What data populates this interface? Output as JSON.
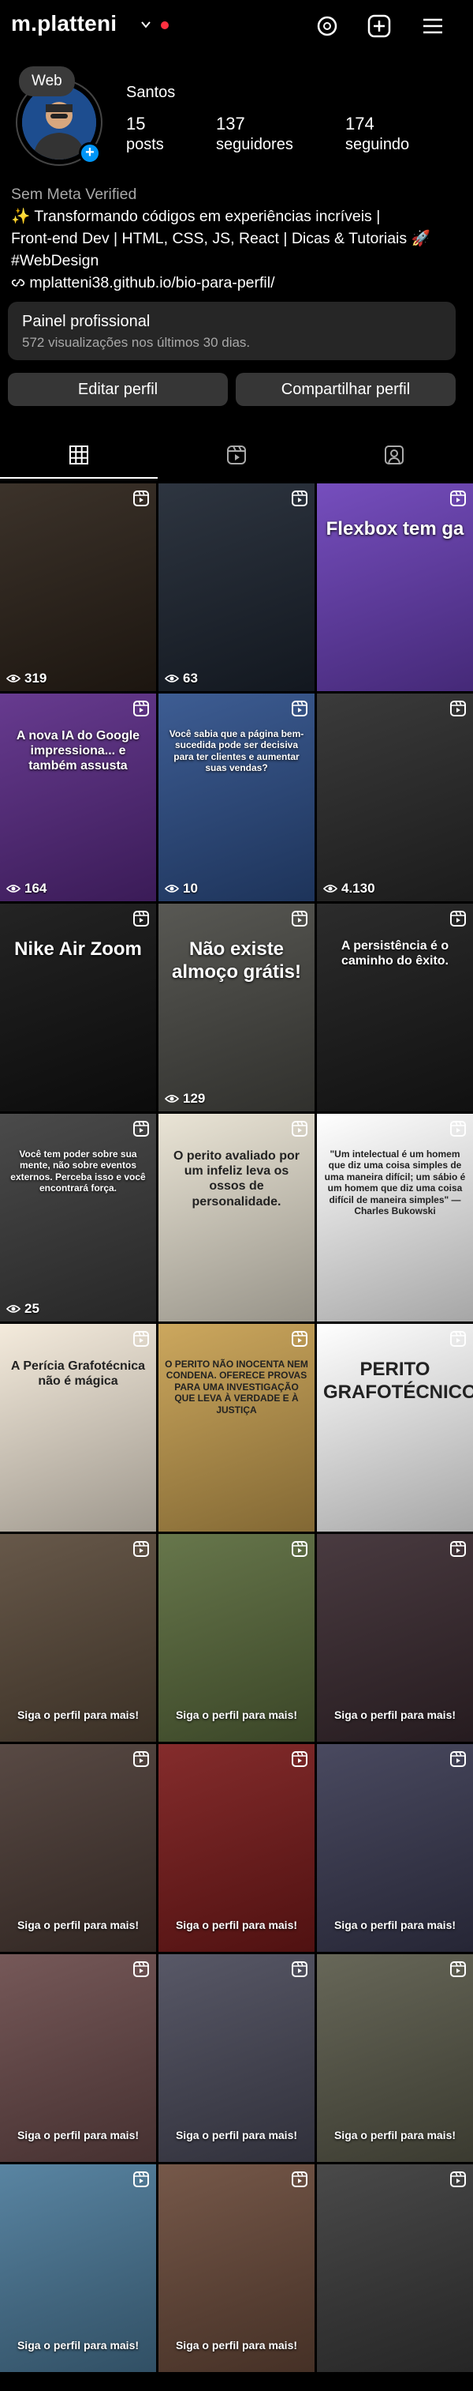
{
  "header": {
    "username": "m.platteni",
    "note": "Web"
  },
  "profile": {
    "full_name": "Santos",
    "stats": [
      {
        "value": "15",
        "label": "posts"
      },
      {
        "value": "137",
        "label": "seguidores"
      },
      {
        "value": "174",
        "label": "seguindo"
      }
    ],
    "meta_verified": "Sem Meta Verified",
    "bio_lines": [
      "✨ Transformando códigos em experiências incríveis |",
      "Front-end Dev | HTML, CSS, JS, React | Dicas & Tutoriais 🚀",
      "#WebDesign"
    ],
    "link": "mplatteni38.github.io/bio-para-perfil/"
  },
  "pro_dashboard": {
    "title": "Painel profissional",
    "subtitle": "572 visualizações nos últimos 30 dias."
  },
  "buttons": {
    "edit": "Editar perfil",
    "share": "Compartilhar perfil"
  },
  "tabs": [
    "posts-grid-icon",
    "reels-icon",
    "tagged-icon"
  ],
  "posts": [
    {
      "views": "319",
      "bg": "#2b2118"
    },
    {
      "views": "63",
      "bg": "#1c2430"
    },
    {
      "views": "",
      "bg": "#6a3fb8",
      "caption": "Flexbox tem ga"
    },
    {
      "views": "164",
      "bg": "#5a2a86",
      "caption": "A nova IA do Google impressiona... e também assusta"
    },
    {
      "views": "10",
      "bg": "#2d4f8a",
      "caption": "Você sabia que a página bem-sucedida pode ser decisiva para ter clientes e aumentar suas vendas?"
    },
    {
      "views": "4.130",
      "bg": "#2a2a2a"
    },
    {
      "views": "",
      "bg": "#111111",
      "caption": "Nike Air Zoom"
    },
    {
      "views": "129",
      "bg": "#4a4a45",
      "caption": "Não existe almoço grátis!"
    },
    {
      "views": "",
      "bg": "#1a1a1a",
      "caption": "A persistência é o caminho do êxito."
    },
    {
      "views": "25",
      "bg": "#3b3b3b",
      "caption": "Você tem poder sobre sua mente, não sobre eventos externos. Perceba isso e você encontrará força."
    },
    {
      "views": "",
      "bg": "#e8e2d2",
      "caption": "O perito avaliado por um infeliz leva os ossos de personalidade."
    },
    {
      "views": "",
      "bg": "#ffffff",
      "caption": "\"Um intelectual é um homem que diz uma coisa simples de uma maneira difícil; um sábio é um homem que diz uma coisa difícil de maneira simples\" — Charles Bukowski"
    },
    {
      "views": "",
      "bg": "#f3e9d9",
      "caption": "A Perícia Grafotécnica não é mágica"
    },
    {
      "views": "",
      "bg": "#c8a050",
      "caption": "O PERITO NÃO INOCENTA NEM CONDENA. OFERECE PROVAS PARA UMA INVESTIGAÇÃO QUE LEVA À VERDADE E À JUSTIÇA"
    },
    {
      "views": "",
      "bg": "#ffffff",
      "caption": "PERITO GRAFOTÉCNICO"
    },
    {
      "views": "",
      "bg": "#5a4a3a",
      "caption": "Siga o perfil para mais!"
    },
    {
      "views": "",
      "bg": "#5a6b3c",
      "caption": "Siga o perfil para mais!"
    },
    {
      "views": "",
      "bg": "#3a2a30",
      "caption": "Siga o perfil para mais!"
    },
    {
      "views": "",
      "bg": "#4a3a34",
      "caption": "Siga o perfil para mais!"
    },
    {
      "views": "",
      "bg": "#7a1a1a",
      "caption": "Siga o perfil para mais!"
    },
    {
      "views": "",
      "bg": "#3a3a52",
      "caption": "Siga o perfil para mais!"
    },
    {
      "views": "",
      "bg": "#6a4a4a",
      "caption": "Siga o perfil para mais!"
    },
    {
      "views": "",
      "bg": "#4a4a5a",
      "caption": "Siga o perfil para mais!"
    },
    {
      "views": "",
      "bg": "#5a5a4a",
      "caption": "Siga o perfil para mais!"
    },
    {
      "views": "",
      "bg": "#4b7a9a",
      "caption": "Siga o perfil para mais!"
    },
    {
      "views": "",
      "bg": "#6a4a3a",
      "caption": "Siga o perfil para mais!"
    },
    {
      "views": "",
      "bg": "#3a3a3a",
      "caption": ""
    }
  ]
}
